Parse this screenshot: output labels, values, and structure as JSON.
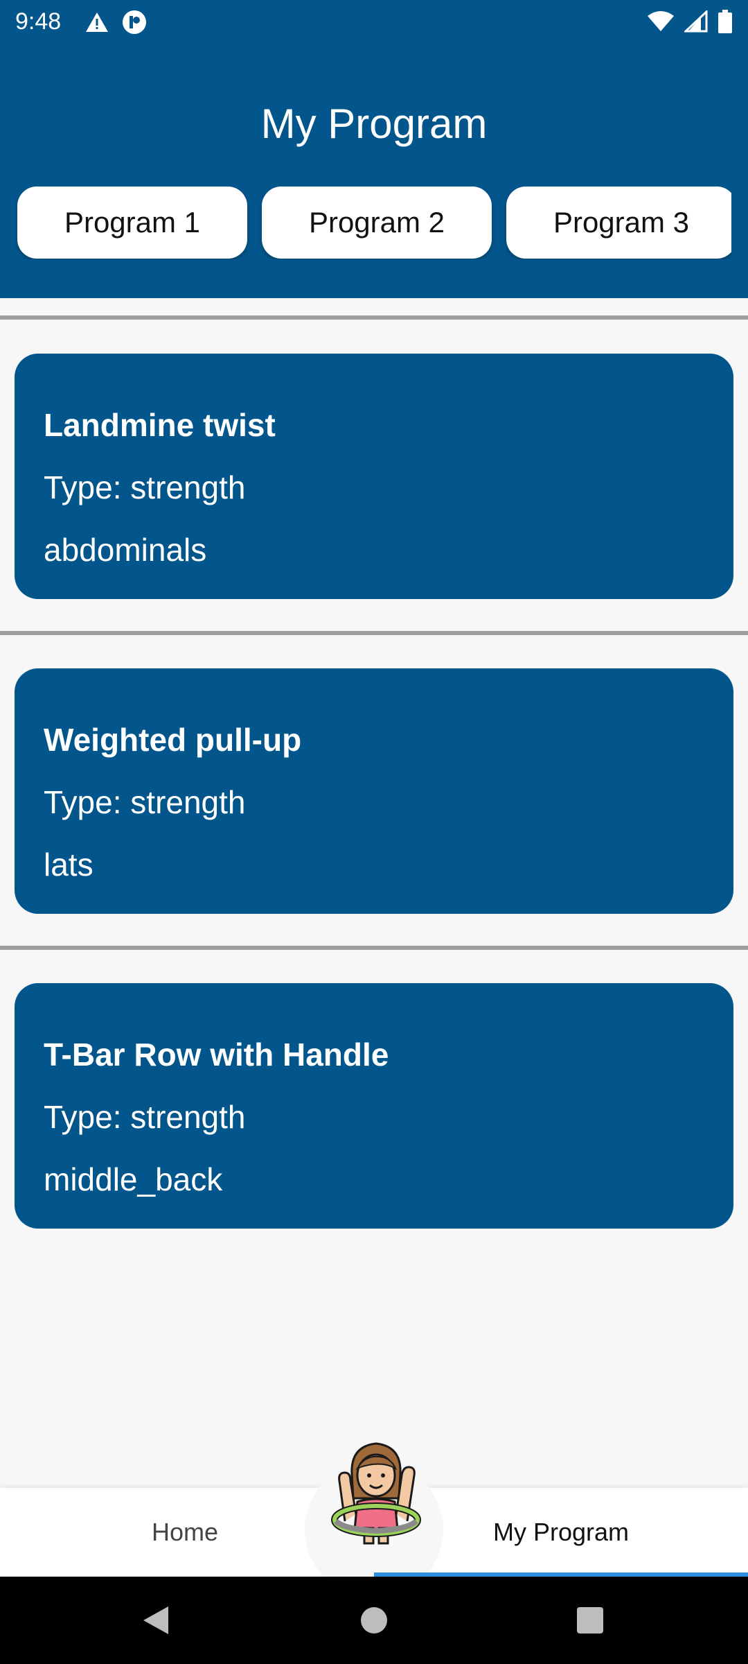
{
  "status_bar": {
    "time": "9:48",
    "left_icons": [
      "warning-icon",
      "app-notification-icon"
    ],
    "right_icons": [
      "wifi-icon",
      "signal-icon",
      "battery-icon"
    ]
  },
  "header": {
    "title": "My Program",
    "background_color": "#03568b"
  },
  "program_tabs": [
    {
      "label": "Program 1"
    },
    {
      "label": "Program 2"
    },
    {
      "label": "Program 3"
    }
  ],
  "exercises": [
    {
      "name": "Landmine twist",
      "type": "Type: strength",
      "muscle": "abdominals"
    },
    {
      "name": "Weighted pull-up",
      "type": "Type: strength",
      "muscle": "lats"
    },
    {
      "name": "T-Bar Row with Handle",
      "type": "Type: strength",
      "muscle": "middle_back"
    }
  ],
  "bottom_nav": {
    "items": [
      {
        "label": "Home"
      },
      {
        "label": "My Program",
        "active": true
      }
    ],
    "center_icon": "mascot-hula-hoop-icon",
    "indicator_color": "#2d8ee0"
  },
  "system_nav": {
    "icons": [
      "back-icon",
      "home-icon",
      "recents-icon"
    ]
  }
}
